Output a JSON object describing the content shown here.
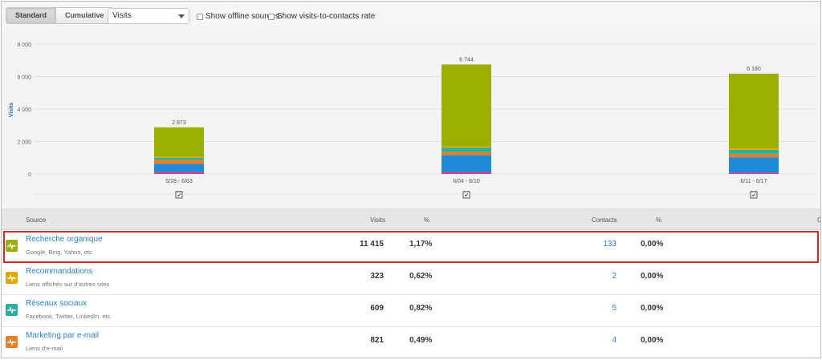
{
  "toolbar": {
    "standard_label": "Standard",
    "cumulative_label": "Cumulative",
    "metric_select": "Visits",
    "offline_label": "Show offline sources",
    "rate_label": "Show visits-to-contacts rate"
  },
  "colors": {
    "organic": "#9aaf00",
    "referrals": "#e0a800",
    "social": "#26b0a0",
    "email": "#e67e22",
    "direct": "#1f8ad8",
    "other": "#d23f8c",
    "highlight": "#e1261c",
    "link": "#2a7fd4"
  },
  "chart_data": {
    "type": "bar",
    "stacked": true,
    "ylabel": "Visits",
    "ylim": [
      0,
      8000
    ],
    "yticks": [
      0,
      2000,
      4000,
      6000,
      8000
    ],
    "ytick_labels": [
      "0",
      "2 000",
      "4 000",
      "6 000",
      "8 000"
    ],
    "categories": [
      "5/28 - 6/03",
      "6/04 - 6/10",
      "6/11 - 6/17"
    ],
    "totals": [
      2873,
      6744,
      6180
    ],
    "total_labels": [
      "2 873",
      "6 744",
      "6 180"
    ],
    "series": [
      {
        "key": "other",
        "values": [
          120,
          120,
          80
        ]
      },
      {
        "key": "direct",
        "values": [
          500,
          1050,
          950
        ]
      },
      {
        "key": "email",
        "values": [
          250,
          200,
          220
        ]
      },
      {
        "key": "social",
        "values": [
          120,
          250,
          230
        ]
      },
      {
        "key": "referrals",
        "values": [
          60,
          80,
          100
        ]
      },
      {
        "key": "organic",
        "values": [
          1823,
          5044,
          4600
        ]
      }
    ],
    "grid": true
  },
  "table": {
    "headers": {
      "source": "Source",
      "visits": "Visits",
      "pct": "%",
      "contacts": "Contacts",
      "pct2": "%",
      "last": "C"
    },
    "rows": [
      {
        "name": "Recherche organique",
        "sub": "Google, Bing, Yahoo, etc.",
        "visits": "11 415",
        "pct": "1,17%",
        "contacts": "133",
        "pct2": "0,00%",
        "color": "#9aaf00",
        "icon": "pulse-icon"
      },
      {
        "name": "Recommandations",
        "sub": "Liens affichés sur d'autres sites",
        "visits": "323",
        "pct": "0,62%",
        "contacts": "2",
        "pct2": "0,00%",
        "color": "#e0a800",
        "icon": "pulse-icon"
      },
      {
        "name": "Réseaux sociaux",
        "sub": "Facebook, Twitter, LinkedIn, etc.",
        "visits": "609",
        "pct": "0,82%",
        "contacts": "5",
        "pct2": "0,00%",
        "color": "#26b0a0",
        "icon": "pulse-icon"
      },
      {
        "name": "Marketing par e-mail",
        "sub": "Liens d'e-mail",
        "visits": "821",
        "pct": "0,49%",
        "contacts": "4",
        "pct2": "0,00%",
        "color": "#e67e22",
        "icon": "pulse-icon"
      }
    ]
  }
}
